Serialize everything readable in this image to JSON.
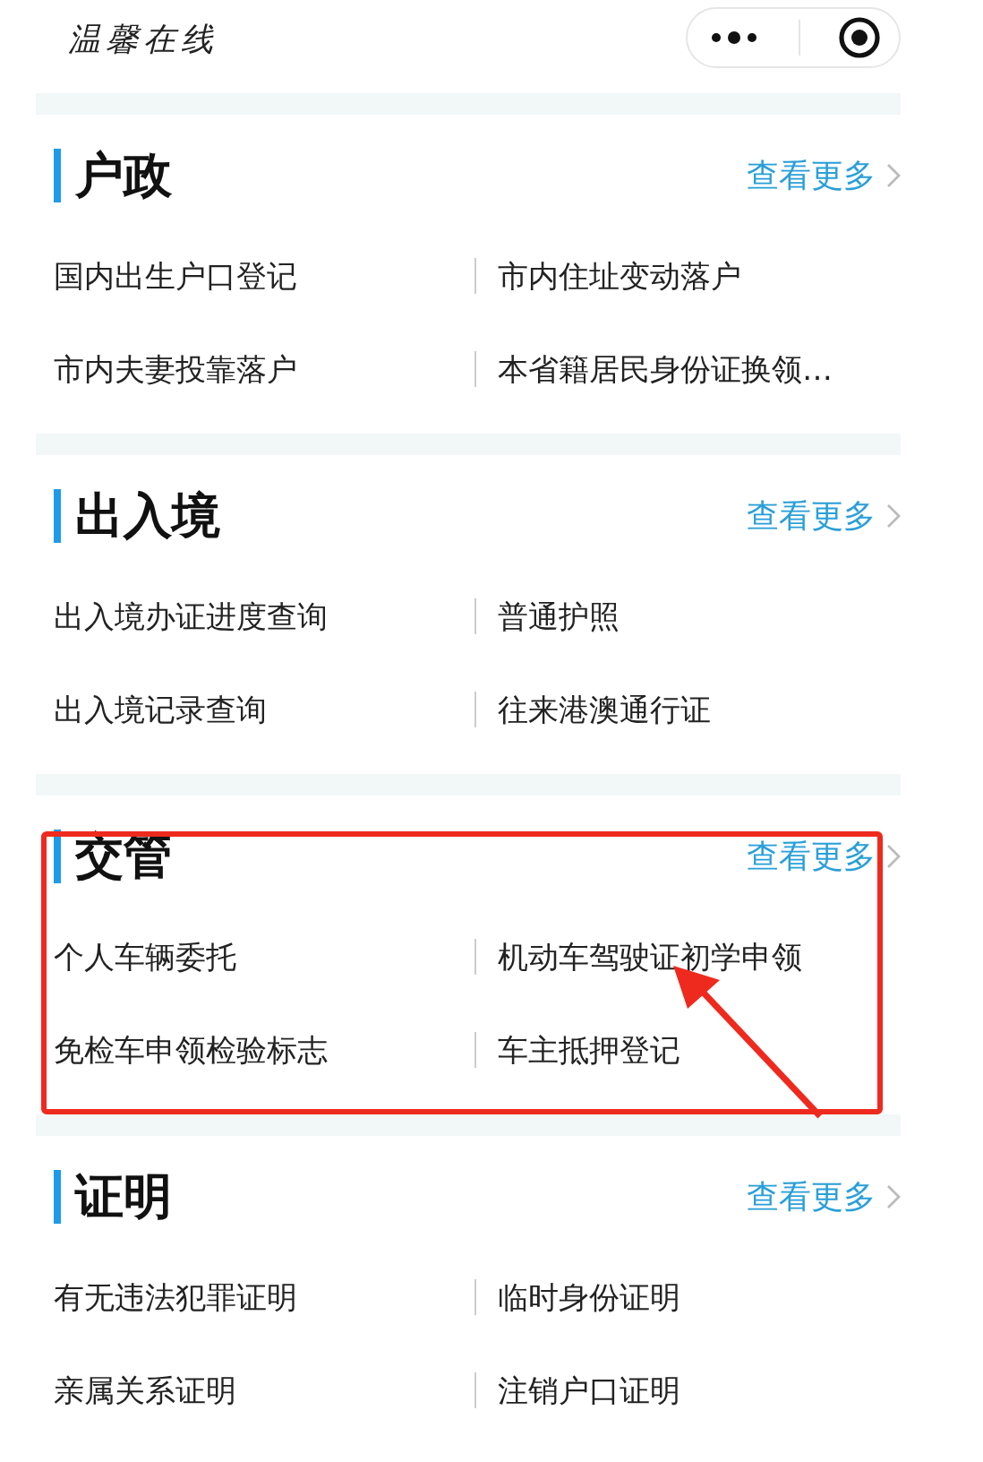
{
  "top_bar": {
    "title": "温馨在线"
  },
  "sections": [
    {
      "title": "户政",
      "more": "查看更多",
      "highlighted": false,
      "items": [
        "国内出生户口登记",
        "市内住址变动落户",
        "市内夫妻投靠落户",
        "本省籍居民身份证换领…"
      ]
    },
    {
      "title": "出入境",
      "more": "查看更多",
      "highlighted": false,
      "items": [
        "出入境办证进度查询",
        "普通护照",
        "出入境记录查询",
        "往来港澳通行证"
      ]
    },
    {
      "title": "交管",
      "more": "查看更多",
      "highlighted": true,
      "items": [
        "个人车辆委托",
        "机动车驾驶证初学申领",
        "免检车申领检验标志",
        "车主抵押登记"
      ]
    },
    {
      "title": "证明",
      "more": "查看更多",
      "highlighted": false,
      "items": [
        "有无违法犯罪证明",
        "临时身份证明",
        "亲属关系证明",
        "注销户口证明"
      ]
    }
  ]
}
